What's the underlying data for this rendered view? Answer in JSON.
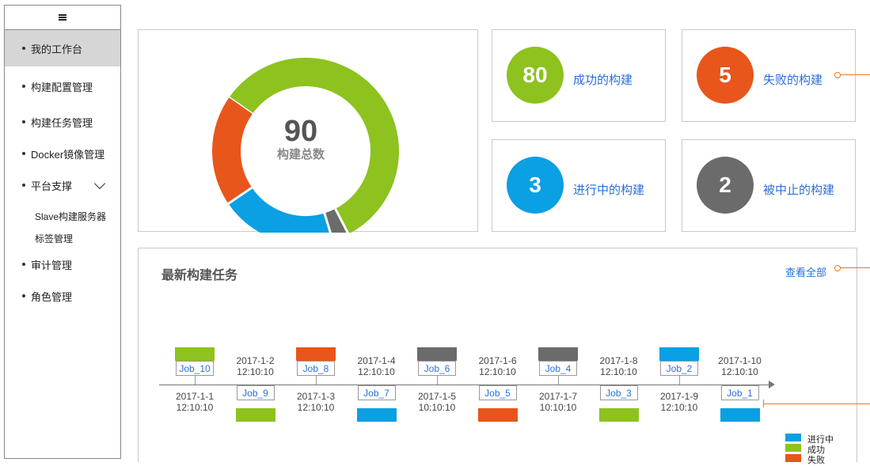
{
  "sidebar": {
    "menu_icon": "hamburger-icon",
    "items": [
      {
        "label": "我的工作台",
        "active": true
      },
      {
        "label": "构建配置管理"
      },
      {
        "label": "构建任务管理"
      },
      {
        "label": "Docker镜像管理"
      },
      {
        "label": "平台支撑"
      },
      {
        "label": "审计管理"
      },
      {
        "label": "角色管理"
      }
    ],
    "subitems": [
      "Slave构建服务器",
      "标签管理"
    ]
  },
  "donut": {
    "total": "90",
    "total_label": "构建总数",
    "segments": [
      {
        "name": "成功",
        "value": 60,
        "color": "#8dc21f"
      },
      {
        "name": "进行中",
        "value": 21,
        "color": "#0b9fe3"
      },
      {
        "name": "失败",
        "value": 20,
        "color": "#e8561b"
      },
      {
        "name": "被中止",
        "value": 3,
        "color": "#6b6b6b"
      }
    ]
  },
  "stats": [
    {
      "value": "80",
      "label": "成功的构建",
      "color": "#8dc21f"
    },
    {
      "value": "5",
      "label": "失败的构建",
      "color": "#e8561b"
    },
    {
      "value": "3",
      "label": "进行中的构建",
      "color": "#0b9fe3"
    },
    {
      "value": "2",
      "label": "被中止的构建",
      "color": "#6b6b6b"
    }
  ],
  "jobs_section": {
    "title": "最新构建任务",
    "view_all": "查看全部",
    "jobs": [
      {
        "name": "Job_10",
        "time_line1": "2017-1-1",
        "time_line2": "12:10:10",
        "color": "#8dc21f"
      },
      {
        "name": "Job_9",
        "time_line1": "2017-1-2",
        "time_line2": "12:10:10",
        "color": "#8dc21f"
      },
      {
        "name": "Job_8",
        "time_line1": "2017-1-3",
        "time_line2": "12:10:10",
        "color": "#e8561b"
      },
      {
        "name": "Job_7",
        "time_line1": "2017-1-4",
        "time_line2": "12:10:10",
        "color": "#0b9fe3"
      },
      {
        "name": "Job_6",
        "time_line1": "2017-1-5",
        "time_line2": "10:10:10",
        "color": "#6b6b6b"
      },
      {
        "name": "Job_5",
        "time_line1": "2017-1-6",
        "time_line2": "12:10:10",
        "color": "#e8561b"
      },
      {
        "name": "Job_4",
        "time_line1": "2017-1-7",
        "time_line2": "10:10:10",
        "color": "#6b6b6b"
      },
      {
        "name": "Job_3",
        "time_line1": "2017-1-8",
        "time_line2": "12:10:10",
        "color": "#8dc21f"
      },
      {
        "name": "Job_2",
        "time_line1": "2017-1-9",
        "time_line2": "12:10:10",
        "color": "#0b9fe3"
      },
      {
        "name": "Job_1",
        "time_line1": "2017-1-10",
        "time_line2": "12:10:10",
        "color": "#0b9fe3"
      }
    ],
    "legend": [
      {
        "label": "进行中",
        "color": "#0b9fe3"
      },
      {
        "label": "成功",
        "color": "#8dc21f"
      },
      {
        "label": "失败",
        "color": "#e8561b"
      }
    ]
  }
}
